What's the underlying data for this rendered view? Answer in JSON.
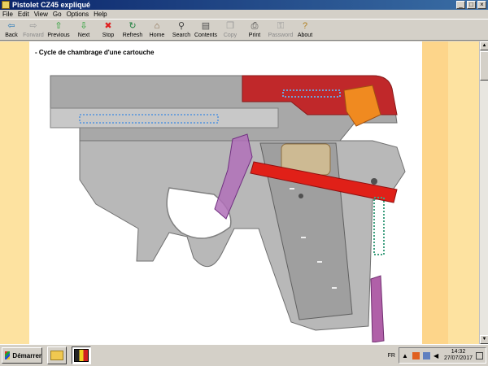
{
  "window": {
    "title": "Pistolet CZ45 expliqué"
  },
  "menu": [
    "File",
    "Edit",
    "View",
    "Go",
    "Options",
    "Help"
  ],
  "toolbar": [
    {
      "label": "Back",
      "icon": "back-arrow-icon",
      "glyph": "⇦",
      "color": "#2a7ab8",
      "enabled": true
    },
    {
      "label": "Forward",
      "icon": "forward-arrow-icon",
      "glyph": "⇨",
      "color": "#9a9a9a",
      "enabled": false
    },
    {
      "label": "Previous",
      "icon": "up-arrow-icon",
      "glyph": "⇧",
      "color": "#22a030",
      "enabled": true
    },
    {
      "label": "Next",
      "icon": "down-arrow-icon",
      "glyph": "⇩",
      "color": "#22a030",
      "enabled": true
    },
    {
      "label": "Stop",
      "icon": "stop-icon",
      "glyph": "✖",
      "color": "#e02020",
      "enabled": true
    },
    {
      "label": "Refresh",
      "icon": "refresh-icon",
      "glyph": "↻",
      "color": "#208040",
      "enabled": true
    },
    {
      "label": "Home",
      "icon": "home-icon",
      "glyph": "⌂",
      "color": "#806040",
      "enabled": true
    },
    {
      "label": "Search",
      "icon": "search-icon",
      "glyph": "⚲",
      "color": "#404040",
      "enabled": true
    },
    {
      "label": "Contents",
      "icon": "contents-icon",
      "glyph": "▤",
      "color": "#505050",
      "enabled": true
    },
    {
      "label": "Copy",
      "icon": "copy-icon",
      "glyph": "❐",
      "color": "#9a9a9a",
      "enabled": false
    },
    {
      "label": "Print",
      "icon": "print-icon",
      "glyph": "⎙",
      "color": "#404040",
      "enabled": true
    },
    {
      "label": "Password",
      "icon": "key-icon",
      "glyph": "⚿",
      "color": "#9a9a9a",
      "enabled": false
    },
    {
      "label": "About",
      "icon": "about-icon",
      "glyph": "?",
      "color": "#b08020",
      "enabled": true
    }
  ],
  "page": {
    "caption": "- Cycle de chambrage d'une cartouche"
  },
  "taskbar": {
    "start_label": "Démarrer",
    "language": "FR",
    "time": "14:32",
    "date": "27/07/2017"
  }
}
